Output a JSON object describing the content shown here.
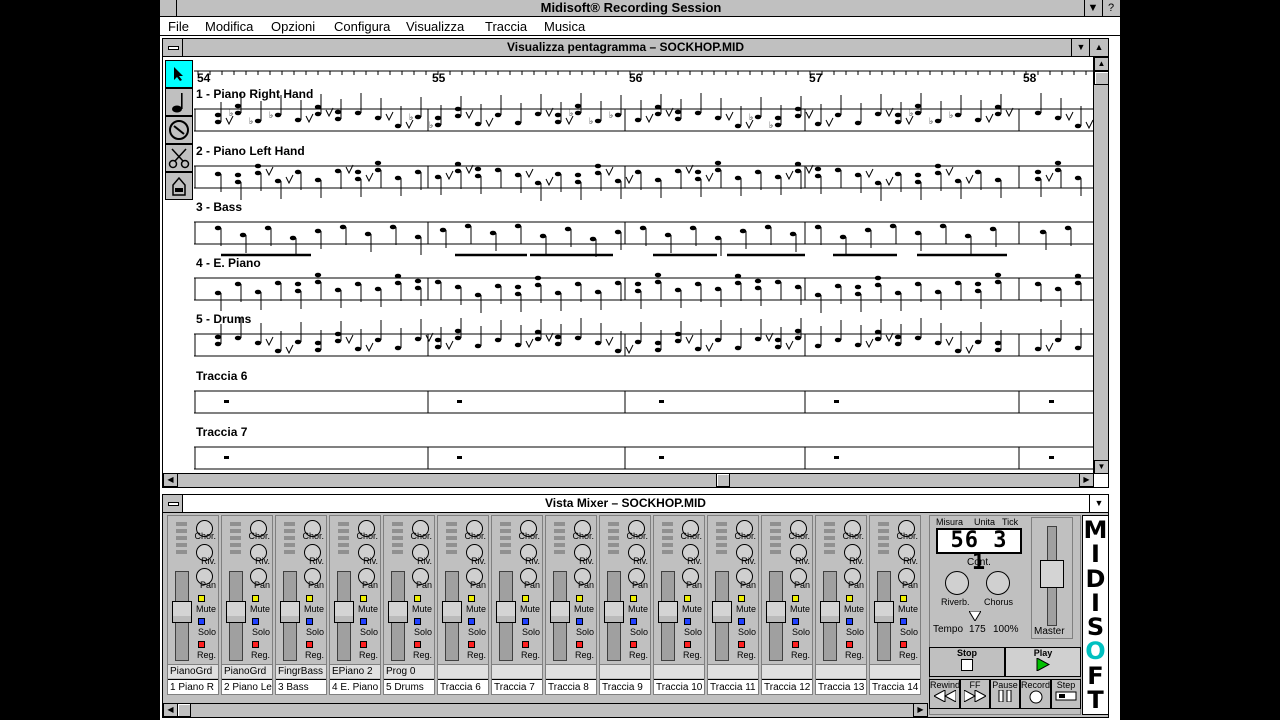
{
  "app": {
    "title": "Midisoft® Recording Session",
    "minimize_glyph": "▼",
    "help_glyph": "?"
  },
  "menu": [
    {
      "label": "File",
      "id": "file"
    },
    {
      "label": "Modifica",
      "id": "modifica"
    },
    {
      "label": "Opzioni",
      "id": "opzioni"
    },
    {
      "label": "Configura",
      "id": "configura"
    },
    {
      "label": "Visualizza",
      "id": "visualizza"
    },
    {
      "label": "Traccia",
      "id": "traccia"
    },
    {
      "label": "Musica",
      "id": "musica"
    }
  ],
  "staff_window": {
    "title": "Visualizza pentagramma – SOCKHOP.MID",
    "measures": [
      "54",
      "55",
      "56",
      "57",
      "58"
    ],
    "tracks": [
      "1 - Piano Right Hand",
      "2 - Piano Left Hand",
      "3 - Bass",
      "4 - E. Piano",
      "5 - Drums",
      "Traccia 6",
      "Traccia 7"
    ],
    "tools": [
      "arrow-tool",
      "note-tool",
      "eraser-tool",
      "scissors-tool",
      "lyric-tool"
    ]
  },
  "mixer_window": {
    "title": "Vista Mixer  – SOCKHOP.MID",
    "labels": {
      "chorus": "Chor.",
      "reverb": "Riv.",
      "pan": "Pan",
      "mute": "Mute",
      "solo": "Solo",
      "reg": "Reg."
    },
    "channels": [
      {
        "program": "PianoGrd",
        "track": "1 Piano R"
      },
      {
        "program": "PianoGrd",
        "track": "2 Piano Le"
      },
      {
        "program": "FingrBass",
        "track": "3 Bass"
      },
      {
        "program": "EPiano 2",
        "track": "4 E. Piano"
      },
      {
        "program": "Prog 0",
        "track": "5 Drums"
      },
      {
        "program": "",
        "track": "Traccia 6"
      },
      {
        "program": "",
        "track": "Traccia 7"
      },
      {
        "program": "",
        "track": "Traccia 8"
      },
      {
        "program": "",
        "track": "Traccia 9"
      },
      {
        "program": "",
        "track": "Traccia 10"
      },
      {
        "program": "",
        "track": "Traccia 11"
      },
      {
        "program": "",
        "track": "Traccia 12"
      },
      {
        "program": "",
        "track": "Traccia 13"
      },
      {
        "program": "",
        "track": "Traccia 14"
      }
    ],
    "master": {
      "counter_labels": [
        "Misura",
        "Unita",
        "Tick"
      ],
      "counter_value": "56  3  1",
      "cont_label": "Cont.",
      "reverb_label": "Riverb.",
      "chorus_label": "Chorus",
      "tempo_label": "Tempo",
      "tempo_value": "175",
      "tempo_percent": "100%",
      "master_label": "Master"
    },
    "transport": {
      "stop": "Stop",
      "play": "Play",
      "rewind": "Rewind",
      "ff": "FF",
      "pause": "Pause",
      "record": "Record",
      "step": "Step"
    },
    "logo": [
      "M",
      "I",
      "D",
      "I",
      "S",
      "O",
      "F",
      "T"
    ]
  }
}
